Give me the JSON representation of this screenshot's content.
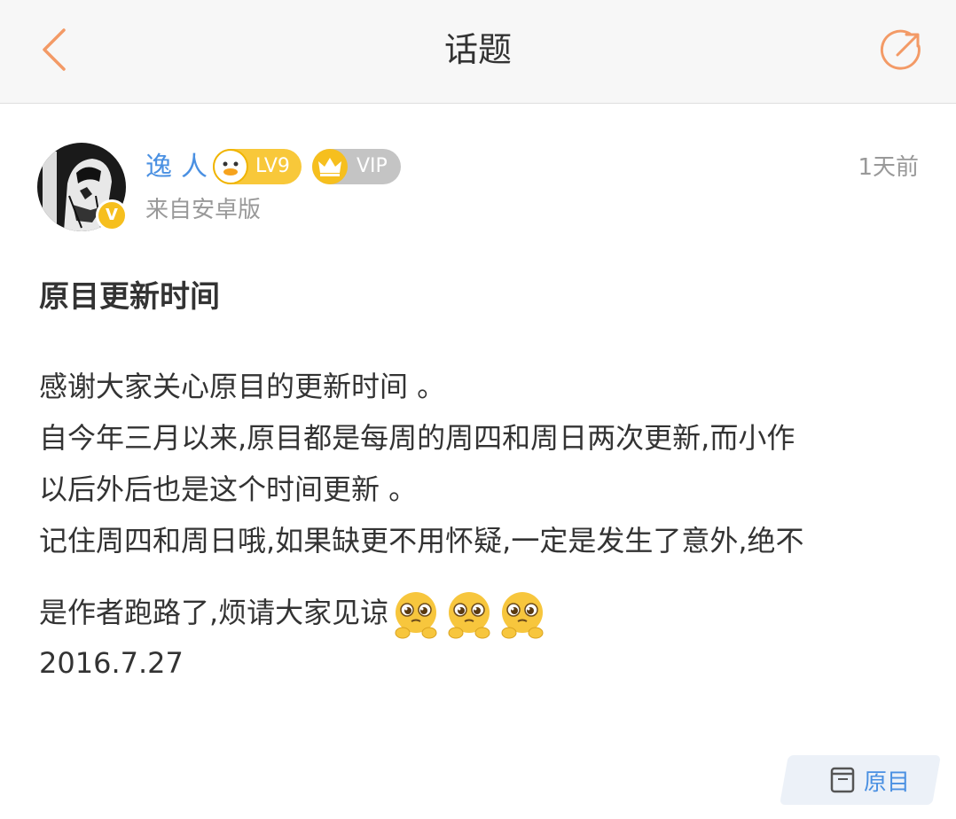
{
  "header": {
    "title": "话题",
    "back_icon": "chevron-left-icon",
    "share_icon": "share-arrow-icon",
    "accent_color": "#f39a66"
  },
  "post": {
    "author": {
      "name": "逸人",
      "level": "LV9",
      "vip": "VIP",
      "verified_badge": "V",
      "source": "来自安卓版"
    },
    "time": "1天前",
    "title": "原目更新时间",
    "body_lines": [
      "感谢大家关心原目的更新时间 。",
      "自今年三月以来,原目都是每周的周四和周日两次更新,而小作",
      "以后外后也是这个时间更新 。",
      "记住周四和周日哦,如果缺更不用怀疑,一定是发生了意外,绝不",
      "是作者跑路了,烦请大家见谅",
      "2016.7.27"
    ],
    "emoji_icons": [
      "pleading-face-icon",
      "pleading-face-icon",
      "pleading-face-icon"
    ]
  },
  "footer": {
    "link_label": "原目",
    "link_icon": "book-icon",
    "link_color": "#4a90e2"
  }
}
